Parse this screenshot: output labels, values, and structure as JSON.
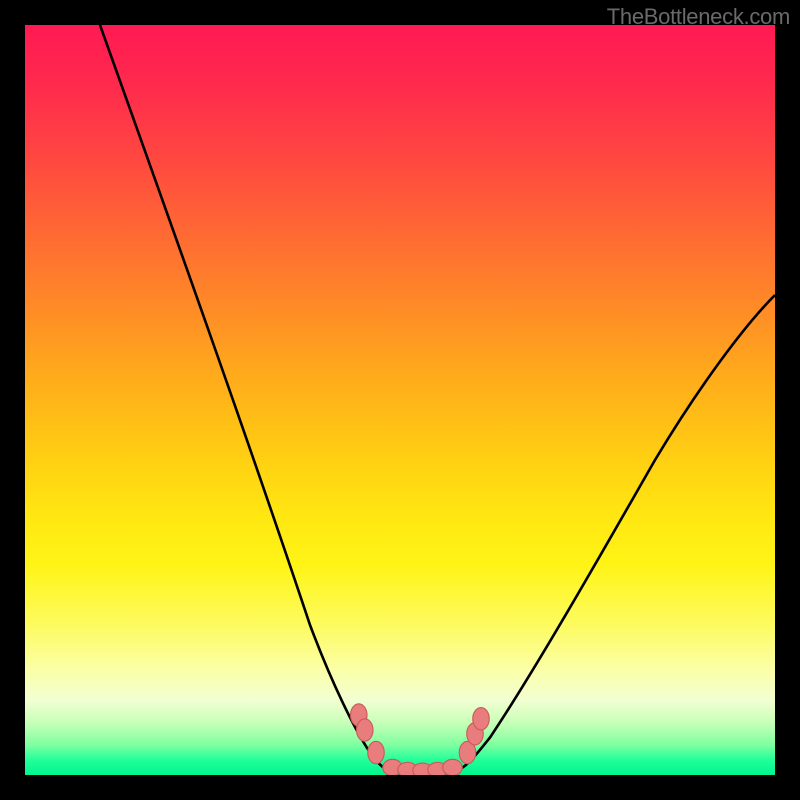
{
  "watermark": "TheBottleneck.com",
  "colors": {
    "frame": "#000000",
    "curve_stroke": "#000000",
    "dot_fill": "#e97c7c",
    "dot_stroke": "#c95a5a"
  },
  "chart_data": {
    "type": "line",
    "title": "",
    "xlabel": "",
    "ylabel": "",
    "ylim": [
      0,
      100
    ],
    "xlim": [
      0,
      100
    ],
    "series": [
      {
        "name": "left-branch",
        "x": [
          10,
          15,
          20,
          25,
          30,
          35,
          38,
          41,
          44,
          46,
          48
        ],
        "values": [
          100,
          86,
          72,
          58,
          44,
          30,
          20,
          12,
          6,
          3,
          1
        ]
      },
      {
        "name": "valley-floor",
        "x": [
          48,
          50,
          52,
          54,
          56,
          58
        ],
        "values": [
          1,
          0,
          0,
          0,
          0,
          1
        ]
      },
      {
        "name": "right-branch",
        "x": [
          58,
          60,
          64,
          70,
          76,
          82,
          88,
          94,
          100
        ],
        "values": [
          1,
          3,
          8,
          17,
          27,
          37,
          47,
          56,
          64
        ]
      }
    ],
    "markers": {
      "name": "dots",
      "x": [
        44.5,
        45.5,
        47,
        49,
        51,
        53,
        55,
        57,
        59,
        60,
        60.5
      ],
      "y": [
        8,
        6,
        3,
        1,
        0.5,
        0.5,
        0.5,
        1,
        3,
        6,
        8
      ]
    }
  }
}
